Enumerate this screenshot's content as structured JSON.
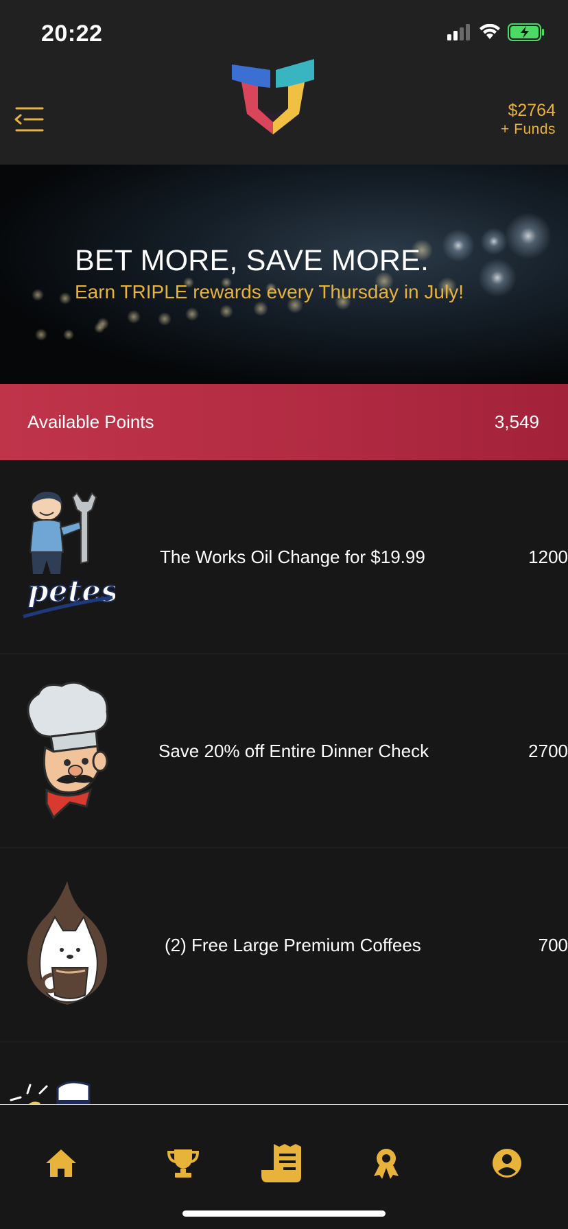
{
  "status_bar": {
    "time": "20:22"
  },
  "header": {
    "funds_amount": "$2764",
    "funds_label": "+ Funds"
  },
  "banner": {
    "title": "BET MORE, SAVE MORE.",
    "subtitle": "Earn TRIPLE rewards every Thursday in July!"
  },
  "points": {
    "label": "Available Points",
    "value": "3,549"
  },
  "rewards": [
    {
      "title": "The Works Oil Change for $19.99",
      "points": "1200",
      "brand_text": "petes"
    },
    {
      "title": "Save 20% off Entire Dinner Check",
      "points": "2700"
    },
    {
      "title": "(2) Free Large Premium Coffees",
      "points": "700"
    }
  ],
  "tabs": [
    {
      "icon": "home-icon"
    },
    {
      "icon": "trophy-icon"
    },
    {
      "icon": "receipt-icon"
    },
    {
      "icon": "award-icon"
    },
    {
      "icon": "profile-icon"
    }
  ],
  "colors": {
    "accent": "#e7b33a",
    "points_bar": "#b02a41",
    "background": "#181818"
  }
}
